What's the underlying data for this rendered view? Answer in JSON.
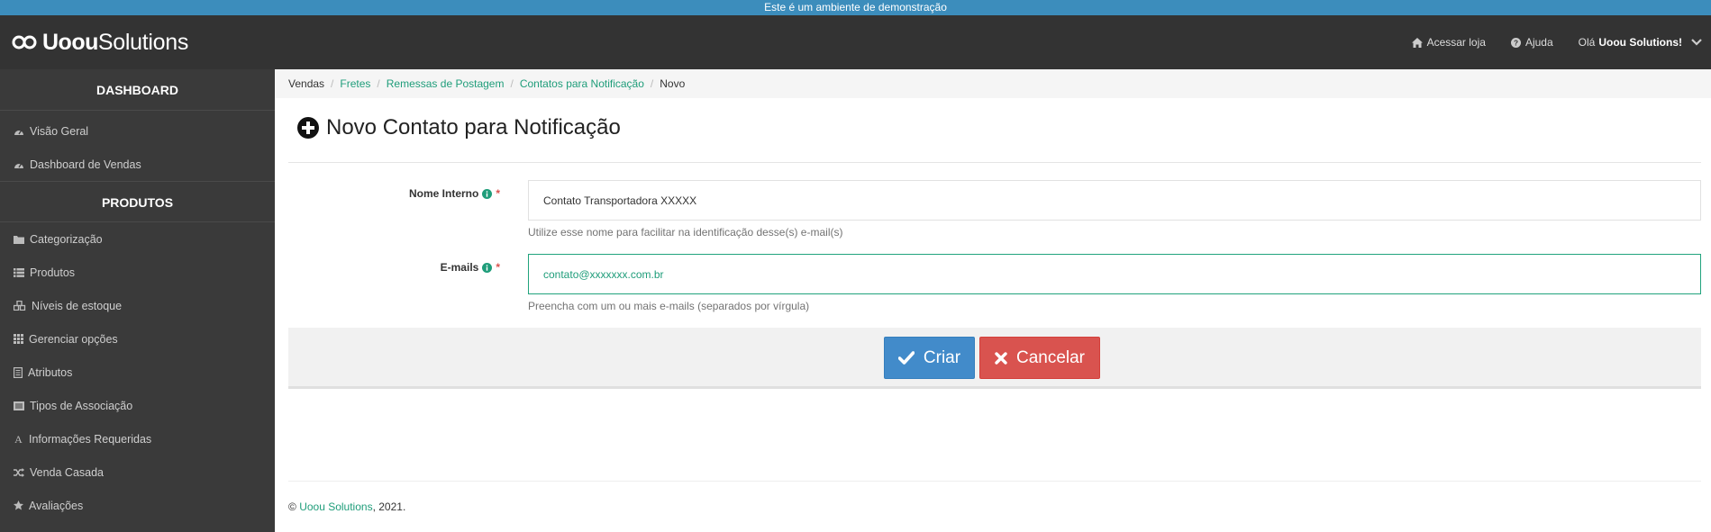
{
  "demo_banner": "Este é um ambiente de demonstração",
  "header": {
    "logo_bold": "Uoou",
    "logo_light": "Solutions",
    "nav": {
      "store": "Acessar loja",
      "help": "Ajuda",
      "greeting": "Olá",
      "user": "Uoou Solutions!"
    }
  },
  "sidebar": {
    "sections": [
      {
        "title": "DASHBOARD",
        "items": [
          {
            "label": "Visão Geral",
            "icon": "dashboard-icon"
          },
          {
            "label": "Dashboard de Vendas",
            "icon": "dashboard-icon"
          }
        ]
      },
      {
        "title": "PRODUTOS",
        "items": [
          {
            "label": "Categorização",
            "icon": "folder-icon"
          },
          {
            "label": "Produtos",
            "icon": "list-icon"
          },
          {
            "label": "Níveis de estoque",
            "icon": "cubes-icon"
          },
          {
            "label": "Gerenciar opções",
            "icon": "grid-icon"
          },
          {
            "label": "Atributos",
            "icon": "document-icon"
          },
          {
            "label": "Tipos de Associação",
            "icon": "list-alt-icon"
          },
          {
            "label": "Informações Requeridas",
            "icon": "font-icon"
          },
          {
            "label": "Venda Casada",
            "icon": "random-icon"
          },
          {
            "label": "Avaliações",
            "icon": "star-icon"
          }
        ]
      }
    ]
  },
  "breadcrumb": {
    "items": [
      "Vendas",
      "Fretes",
      "Remessas de Postagem",
      "Contatos para Notificação"
    ],
    "current": "Novo",
    "separator": "/"
  },
  "page": {
    "title": "Novo Contato para Notificação"
  },
  "form": {
    "name": {
      "label": "Nome Interno",
      "required": "*",
      "value": "Contato Transportadora XXXXX",
      "help": "Utilize esse nome para facilitar na identificação desse(s) e-mail(s)"
    },
    "emails": {
      "label": "E-mails",
      "required": "*",
      "value": "contato@xxxxxxx.com.br",
      "help": "Preencha com um ou mais e-mails (separados por vírgula)"
    }
  },
  "actions": {
    "create": "Criar",
    "cancel": "Cancelar"
  },
  "footer": {
    "prefix": "©",
    "company": "Uoou Solutions",
    "suffix": ", 2021."
  },
  "colors": {
    "accent": "#1f9d7a",
    "primary": "#428bca",
    "danger": "#d9534f",
    "topbar": "#333333",
    "sidebar": "#3a3a3a",
    "demo_bar": "#3c8dbc"
  }
}
